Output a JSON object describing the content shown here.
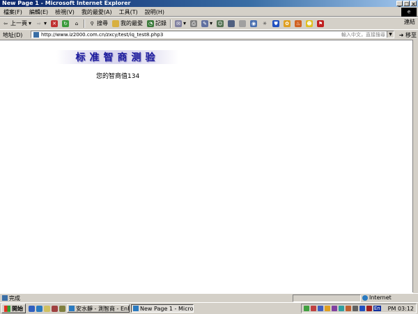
{
  "window": {
    "title": "New Page 1 - Microsoft Internet Explorer",
    "controls": [
      "_",
      "□",
      "×"
    ]
  },
  "menu": [
    "檔案(F)",
    "編輯(E)",
    "檢視(V)",
    "我的最愛(A)",
    "工具(T)",
    "說明(H)"
  ],
  "toolbar": {
    "back": "上一頁",
    "search": "搜尋",
    "favorites": "我的最愛",
    "history": "記錄"
  },
  "address": {
    "label": "地址(D)",
    "url": "http://www.iz2000.com.cn/zxcy/test/iq_test8.php3",
    "search_hint": "輸入中文，直接搜尋",
    "go": "移至",
    "links": "連結"
  },
  "page": {
    "banner": "标准智商测验",
    "result": "您的智商值134"
  },
  "status": {
    "text": "完成",
    "zone": "Internet"
  },
  "taskbar": {
    "start": "開始",
    "tasks": [
      "安水靜 - 測智商 - EnFun...",
      "New Page 1 - Microsoft Int..."
    ],
    "ime": "En",
    "clock": "PM 03:12"
  }
}
